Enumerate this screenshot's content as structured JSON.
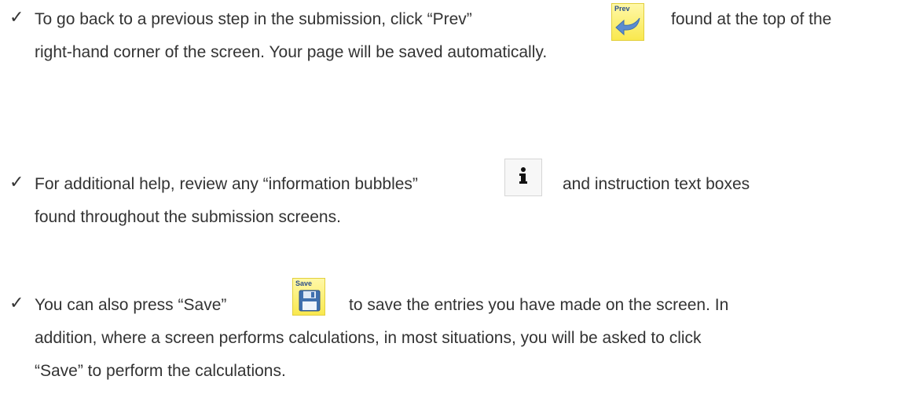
{
  "icons": {
    "check": "check-mark-icon",
    "prev": "prev-arrow-icon",
    "info": "info-icon",
    "save": "floppy-disk-icon"
  },
  "prev_button_label": "Prev",
  "save_button_label": "Save",
  "bullets": [
    {
      "line1_before": "To go back to a previous step in the submission, click “Prev”",
      "line1_after": "found at the top of the",
      "line2": "right-hand corner of the screen. Your page will be saved automatically."
    },
    {
      "line1_before": "For additional help, review any “information bubbles”",
      "line1_after": "and instruction text boxes",
      "line2": "found throughout the submission screens."
    },
    {
      "line1_before": "You can also press “Save”",
      "line1_after": "to save the entries you have made on the screen. In",
      "line2": "addition, where a screen performs calculations, in most situations, you will be asked to click",
      "line3": "“Save” to perform the calculations."
    }
  ],
  "colors": {
    "text": "#333333",
    "button_yellow": "#f9e84e",
    "button_label_blue": "#2c4f8a",
    "arrow_blue": "#5b8ccf"
  }
}
